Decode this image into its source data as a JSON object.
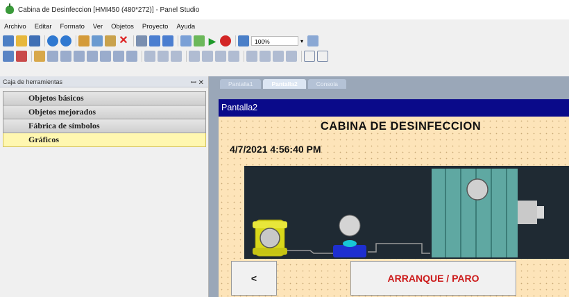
{
  "window": {
    "title": "Cabina de Desinfeccion [HMI450 (480*272)] - Panel Studio"
  },
  "menu": [
    "Archivo",
    "Editar",
    "Formato",
    "Ver",
    "Objetos",
    "Proyecto",
    "Ayuda"
  ],
  "toolbar": {
    "zoom_value": "100%"
  },
  "toolbox": {
    "title": "Caja de herramientas",
    "pin_close": "$ X",
    "categories": [
      {
        "label": "Objetos básicos"
      },
      {
        "label": "Objetos mejorados"
      },
      {
        "label": "Fábrica de símbolos"
      },
      {
        "label": "Gráficos"
      }
    ]
  },
  "tabs": [
    "Pantalla1",
    "Pantalla2",
    "Consola"
  ],
  "screen": {
    "name": "Pantalla2",
    "title": "CABINA DE DESINFECCION",
    "datetime": "4/7/2021 4:56:40 PM",
    "back_button": "<",
    "start_stop_button": "ARRANQUE / PARO"
  },
  "colors": {
    "screen_header": "#0a0a8a",
    "screen_background": "#fde4b9",
    "diagram_background": "#1f2a33",
    "start_stop_text": "#cc1a1a",
    "active_category": "#fff7b0"
  }
}
